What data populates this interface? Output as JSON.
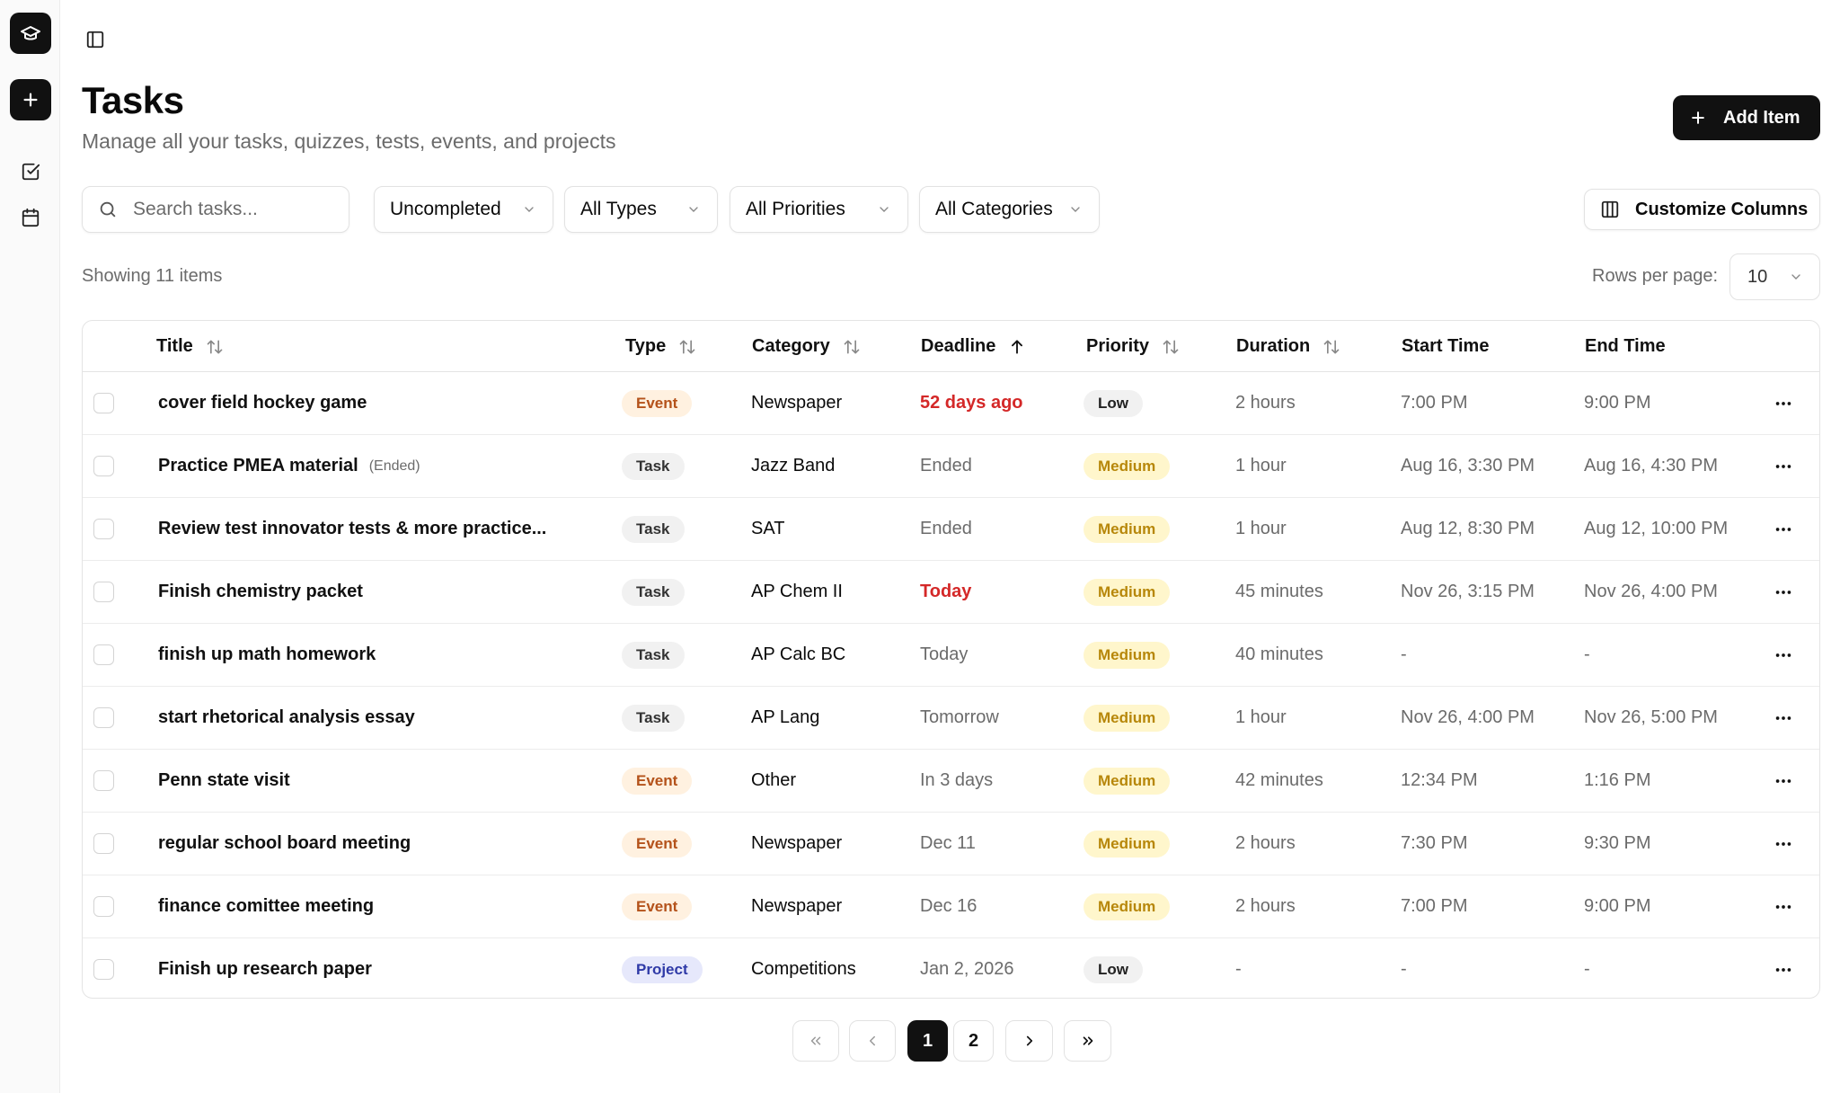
{
  "page": {
    "title": "Tasks",
    "subtitle": "Manage all your tasks, quizzes, tests, events, and projects"
  },
  "actions": {
    "add_item": "Add Item",
    "customize_columns": "Customize Columns"
  },
  "search": {
    "placeholder": "Search tasks..."
  },
  "filters": [
    {
      "value": "Uncompleted"
    },
    {
      "value": "All Types"
    },
    {
      "value": "All Priorities"
    },
    {
      "value": "All Categories"
    }
  ],
  "summary": {
    "showing": "Showing 11 items",
    "rows_per_page_label": "Rows per page:",
    "rows_per_page_value": "10"
  },
  "columns": [
    "Title",
    "Type",
    "Category",
    "Deadline",
    "Priority",
    "Duration",
    "Start Time",
    "End Time"
  ],
  "rows": [
    {
      "title": "cover field hockey game",
      "suffix": "",
      "type": "Event",
      "category": "Newspaper",
      "deadline": "52 days ago",
      "priority": "Low",
      "duration": "2 hours",
      "start": "7:00 PM",
      "end": "9:00 PM"
    },
    {
      "title": "Practice PMEA material",
      "suffix": "(Ended)",
      "type": "Task",
      "category": "Jazz Band",
      "deadline": "Ended",
      "priority": "Medium",
      "duration": "1 hour",
      "start": "Aug 16, 3:30 PM",
      "end": "Aug 16, 4:30 PM"
    },
    {
      "title": "Review test innovator tests & more practice...",
      "suffix": "",
      "type": "Task",
      "category": "SAT",
      "deadline": "Ended",
      "priority": "Medium",
      "duration": "1 hour",
      "start": "Aug 12, 8:30 PM",
      "end": "Aug 12, 10:00 PM"
    },
    {
      "title": "Finish chemistry packet",
      "suffix": "",
      "type": "Task",
      "category": "AP Chem II",
      "deadline": "Today",
      "priority": "Medium",
      "duration": "45 minutes",
      "start": "Nov 26, 3:15 PM",
      "end": "Nov 26, 4:00 PM"
    },
    {
      "title": "finish up math homework",
      "suffix": "",
      "type": "Task",
      "category": "AP Calc BC",
      "deadline": "Today",
      "priority": "Medium",
      "duration": "40 minutes",
      "start": "-",
      "end": "-"
    },
    {
      "title": "start rhetorical analysis essay",
      "suffix": "",
      "type": "Task",
      "category": "AP Lang",
      "deadline": "Tomorrow",
      "priority": "Medium",
      "duration": "1 hour",
      "start": "Nov 26, 4:00 PM",
      "end": "Nov 26, 5:00 PM"
    },
    {
      "title": "Penn state visit",
      "suffix": "",
      "type": "Event",
      "category": "Other",
      "deadline": "In 3 days",
      "priority": "Medium",
      "duration": "42 minutes",
      "start": "12:34 PM",
      "end": "1:16 PM"
    },
    {
      "title": "regular school board meeting",
      "suffix": "",
      "type": "Event",
      "category": "Newspaper",
      "deadline": "Dec 11",
      "priority": "Medium",
      "duration": "2 hours",
      "start": "7:30 PM",
      "end": "9:30 PM"
    },
    {
      "title": "finance comittee meeting",
      "suffix": "",
      "type": "Event",
      "category": "Newspaper",
      "deadline": "Dec 16",
      "priority": "Medium",
      "duration": "2 hours",
      "start": "7:00 PM",
      "end": "9:00 PM"
    },
    {
      "title": "Finish up research paper",
      "suffix": "",
      "type": "Project",
      "category": "Competitions",
      "deadline": "Jan 2, 2026",
      "priority": "Low",
      "duration": "-",
      "start": "-",
      "end": "-"
    }
  ],
  "pagination": {
    "pages": [
      "1",
      "2"
    ],
    "current": "1"
  },
  "colors": {
    "accent": "#111111",
    "overdue": "#d42828",
    "event_bg": "#fff1e0",
    "medium_bg": "#fff6cc",
    "project_bg": "#e6e8fb"
  }
}
